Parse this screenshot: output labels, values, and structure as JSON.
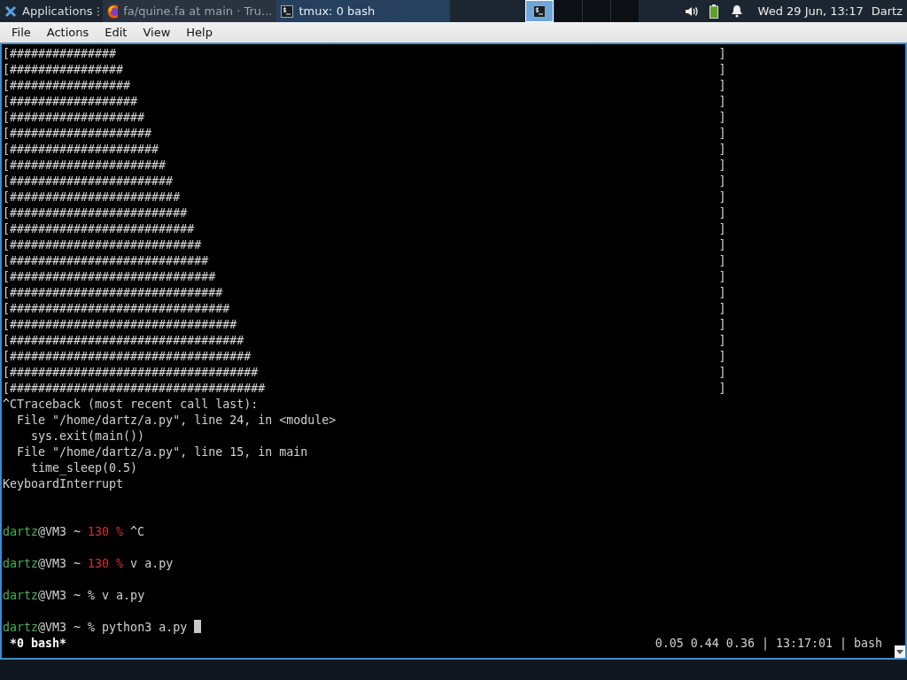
{
  "taskbar": {
    "menu_label": "Applications",
    "tasks": [
      {
        "kind": "browser",
        "label": "fa/quine.fa at main · Tru...",
        "selected": false
      },
      {
        "kind": "terminal",
        "label": "tmux: 0 bash",
        "selected": true
      }
    ],
    "workspaces": [
      {
        "selected": true
      },
      {
        "selected": false
      },
      {
        "selected": false
      },
      {
        "selected": false
      }
    ],
    "clock": "Wed 29 Jun, 13:17",
    "user": "Dartz"
  },
  "menu_bar": [
    "File",
    "Actions",
    "Edit",
    "View",
    "Help"
  ],
  "terminal": {
    "lines": [
      {
        "kind": "output",
        "text": "[###############                                                                                     ]"
      },
      {
        "kind": "output",
        "text": "[################                                                                                    ]"
      },
      {
        "kind": "output",
        "text": "[#################                                                                                   ]"
      },
      {
        "kind": "output",
        "text": "[##################                                                                                  ]"
      },
      {
        "kind": "output",
        "text": "[###################                                                                                 ]"
      },
      {
        "kind": "output",
        "text": "[####################                                                                                ]"
      },
      {
        "kind": "output",
        "text": "[#####################                                                                               ]"
      },
      {
        "kind": "output",
        "text": "[######################                                                                              ]"
      },
      {
        "kind": "output",
        "text": "[#######################                                                                             ]"
      },
      {
        "kind": "output",
        "text": "[########################                                                                            ]"
      },
      {
        "kind": "output",
        "text": "[#########################                                                                           ]"
      },
      {
        "kind": "output",
        "text": "[##########################                                                                          ]"
      },
      {
        "kind": "output",
        "text": "[###########################                                                                         ]"
      },
      {
        "kind": "output",
        "text": "[############################                                                                        ]"
      },
      {
        "kind": "output",
        "text": "[#############################                                                                       ]"
      },
      {
        "kind": "output",
        "text": "[##############################                                                                      ]"
      },
      {
        "kind": "output",
        "text": "[###############################                                                                     ]"
      },
      {
        "kind": "output",
        "text": "[################################                                                                    ]"
      },
      {
        "kind": "output",
        "text": "[#################################                                                                   ]"
      },
      {
        "kind": "output",
        "text": "[##################################                                                                  ]"
      },
      {
        "kind": "output",
        "text": "[###################################                                                                 ]"
      },
      {
        "kind": "output",
        "text": "[####################################                                                                ]"
      },
      {
        "kind": "output",
        "text": "^CTraceback (most recent call last):"
      },
      {
        "kind": "output",
        "text": "  File \"/home/dartz/a.py\", line 24, in <module>"
      },
      {
        "kind": "output",
        "text": "    sys.exit(main())"
      },
      {
        "kind": "output",
        "text": "  File \"/home/dartz/a.py\", line 15, in main"
      },
      {
        "kind": "output",
        "text": "    time_sleep(0.5)"
      },
      {
        "kind": "output",
        "text": "KeyboardInterrupt"
      },
      {
        "kind": "blank"
      },
      {
        "kind": "blank"
      },
      {
        "kind": "prompt",
        "user": "dartz",
        "host": "@VM3",
        "cwd": "~",
        "exit_code": "130",
        "symbol": "%",
        "command": "^C",
        "cursor": false
      },
      {
        "kind": "blank"
      },
      {
        "kind": "prompt",
        "user": "dartz",
        "host": "@VM3",
        "cwd": "~",
        "exit_code": "130",
        "symbol": "%",
        "command": "v a.py",
        "cursor": false
      },
      {
        "kind": "blank"
      },
      {
        "kind": "prompt",
        "user": "dartz",
        "host": "@VM3",
        "cwd": "~",
        "symbol": "%",
        "command": "v a.py",
        "cursor": false
      },
      {
        "kind": "blank"
      },
      {
        "kind": "prompt",
        "user": "dartz",
        "host": "@VM3",
        "cwd": "~",
        "symbol": "%",
        "command": "python3 a.py",
        "cursor": true
      }
    ],
    "status_left": "*0 bash*",
    "status_right": "0.05 0.44 0.36 | 13:17:01 | bash"
  }
}
